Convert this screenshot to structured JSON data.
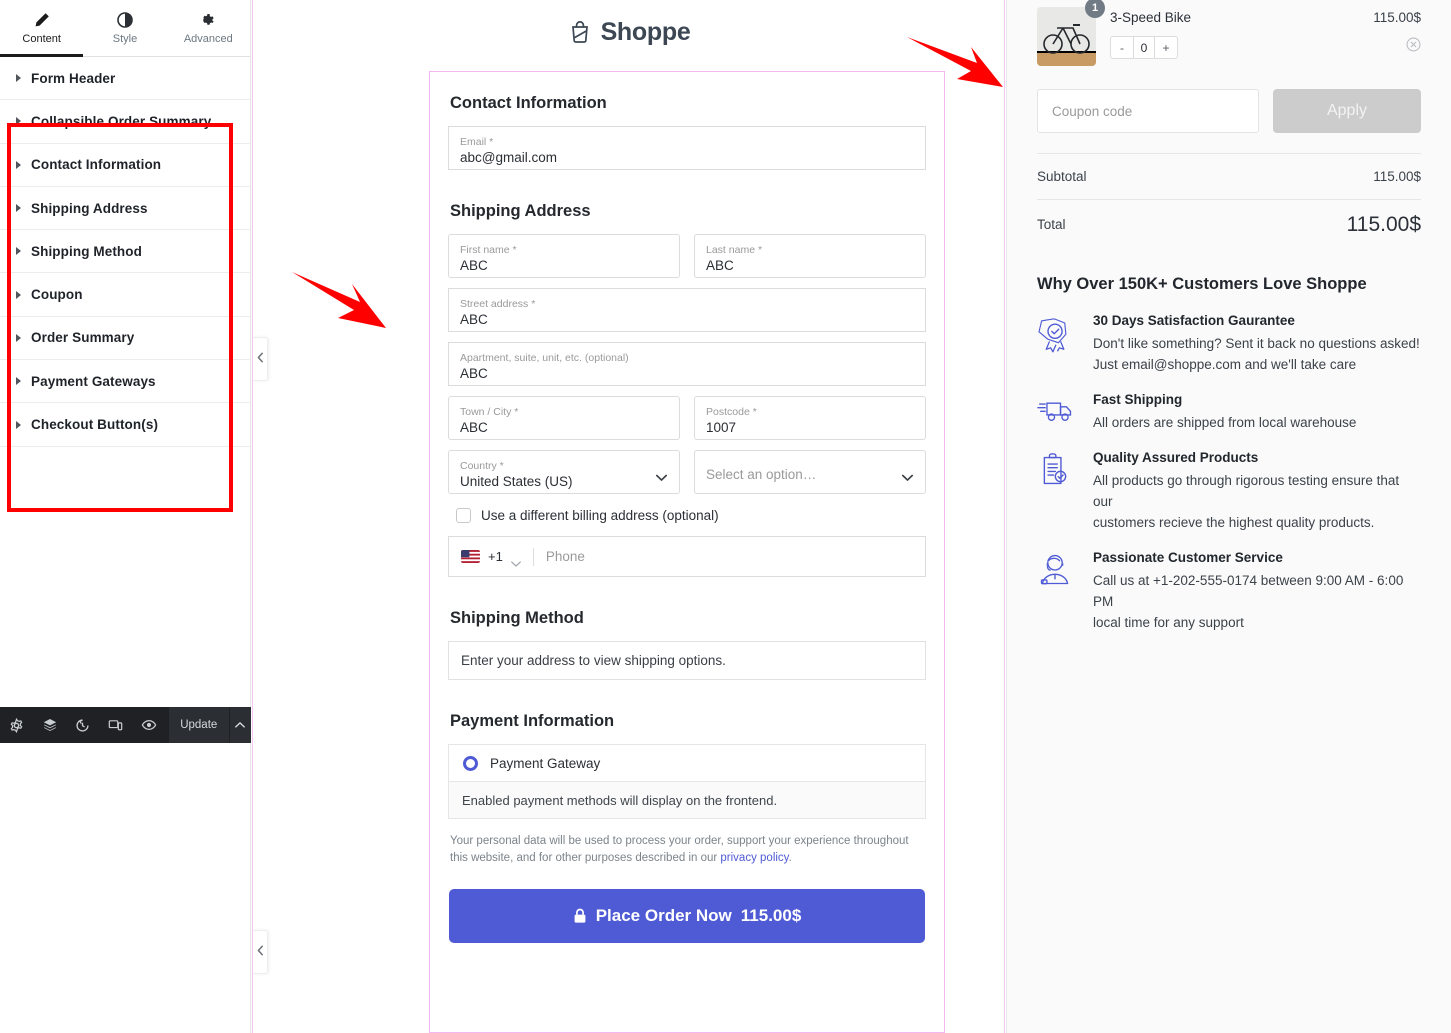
{
  "editor": {
    "tabs": [
      {
        "label": "Content",
        "icon": "pencil-icon",
        "active": true
      },
      {
        "label": "Style",
        "icon": "contrast-icon",
        "active": false
      },
      {
        "label": "Advanced",
        "icon": "gear-icon",
        "active": false
      }
    ],
    "sections": [
      {
        "label": "Form Header"
      },
      {
        "label": "Collapsible Order Summary"
      },
      {
        "label": "Contact Information"
      },
      {
        "label": "Shipping Address"
      },
      {
        "label": "Shipping Method"
      },
      {
        "label": "Coupon"
      },
      {
        "label": "Order Summary"
      },
      {
        "label": "Payment Gateways"
      },
      {
        "label": "Checkout Button(s)"
      }
    ],
    "bottom_bar": {
      "icons": [
        "settings-gear-icon",
        "layers-icon",
        "history-icon",
        "responsive-mode-icon",
        "preview-eye-icon"
      ],
      "update_label": "Update",
      "caret": "chevron-up-icon"
    },
    "highlight_color": "#ff0000"
  },
  "canvas": {
    "brand": {
      "name": "Shoppe",
      "icon": "shopping-bag-icon"
    },
    "contact": {
      "title": "Contact Information",
      "email": {
        "label": "Email *",
        "value": "abc@gmail.com"
      }
    },
    "shipping_address": {
      "title": "Shipping Address",
      "first_name": {
        "label": "First name *",
        "value": "ABC"
      },
      "last_name": {
        "label": "Last name *",
        "value": "ABC"
      },
      "street": {
        "label": "Street address *",
        "value": "ABC"
      },
      "apartment": {
        "label": "Apartment, suite, unit, etc. (optional)",
        "value": "ABC"
      },
      "city": {
        "label": "Town / City *",
        "value": "ABC"
      },
      "postcode": {
        "label": "Postcode *",
        "value": "1007"
      },
      "country": {
        "label": "Country *",
        "value": "United States (US)"
      },
      "state": {
        "placeholder": "Select an option…"
      },
      "billing_checkbox": {
        "label": "Use a different billing address (optional)",
        "checked": false
      },
      "phone": {
        "dial_code": "+1",
        "flag": "us-flag-icon",
        "placeholder": "Phone"
      }
    },
    "shipping_method": {
      "title": "Shipping Method",
      "notice": "Enter your address to view shipping options."
    },
    "payment": {
      "title": "Payment Information",
      "gateway_label": "Payment Gateway",
      "gateway_selected": true,
      "note": "Enabled payment methods will display on the frontend."
    },
    "privacy": {
      "text": "Your personal data will be used to process your order, support your experience throughout this website, and for other purposes described in our ",
      "link": "privacy policy",
      "suffix": "."
    },
    "place_order": {
      "icon": "lock-icon",
      "label": "Place Order Now",
      "amount": "115.00$",
      "color": "#4f5bd5"
    },
    "collapse_handle_icon": "chevron-left-icon"
  },
  "summary": {
    "cart_item": {
      "name": "3-Speed Bike",
      "price": "115.00$",
      "qty_badge": "1",
      "image": "bicycle-photo",
      "stepper": {
        "minus": "-",
        "value": "0",
        "plus": "+"
      },
      "remove_icon": "remove-circle-icon"
    },
    "coupon": {
      "placeholder": "Coupon code",
      "apply_label": "Apply"
    },
    "totals": [
      {
        "label": "Subtotal",
        "value": "115.00$"
      },
      {
        "label": "Total",
        "value": "115.00$"
      }
    ],
    "why_title": "Why Over 150K+ Customers Love Shoppe",
    "benefits": [
      {
        "icon": "guarantee-badge-icon",
        "title": "30 Days Satisfaction Gaurantee",
        "line1": "Don't like something? Sent it back no questions asked!",
        "line2": "Just email@shoppe.com and we'll take care"
      },
      {
        "icon": "delivery-truck-icon",
        "title": "Fast Shipping",
        "line1": "All orders are shipped from local warehouse",
        "line2": ""
      },
      {
        "icon": "clipboard-check-icon",
        "title": "Quality Assured Products",
        "line1": "All products go through rigorous testing ensure that our",
        "line2": "customers recieve the highest quality products."
      },
      {
        "icon": "headset-agent-icon",
        "title": "Passionate Customer Service",
        "line1": "Call us at +1-202-555-0174 between 9:00 AM - 6:00 PM",
        "line2": "local time for any support"
      }
    ],
    "accent_color": "#4f5bd5"
  }
}
